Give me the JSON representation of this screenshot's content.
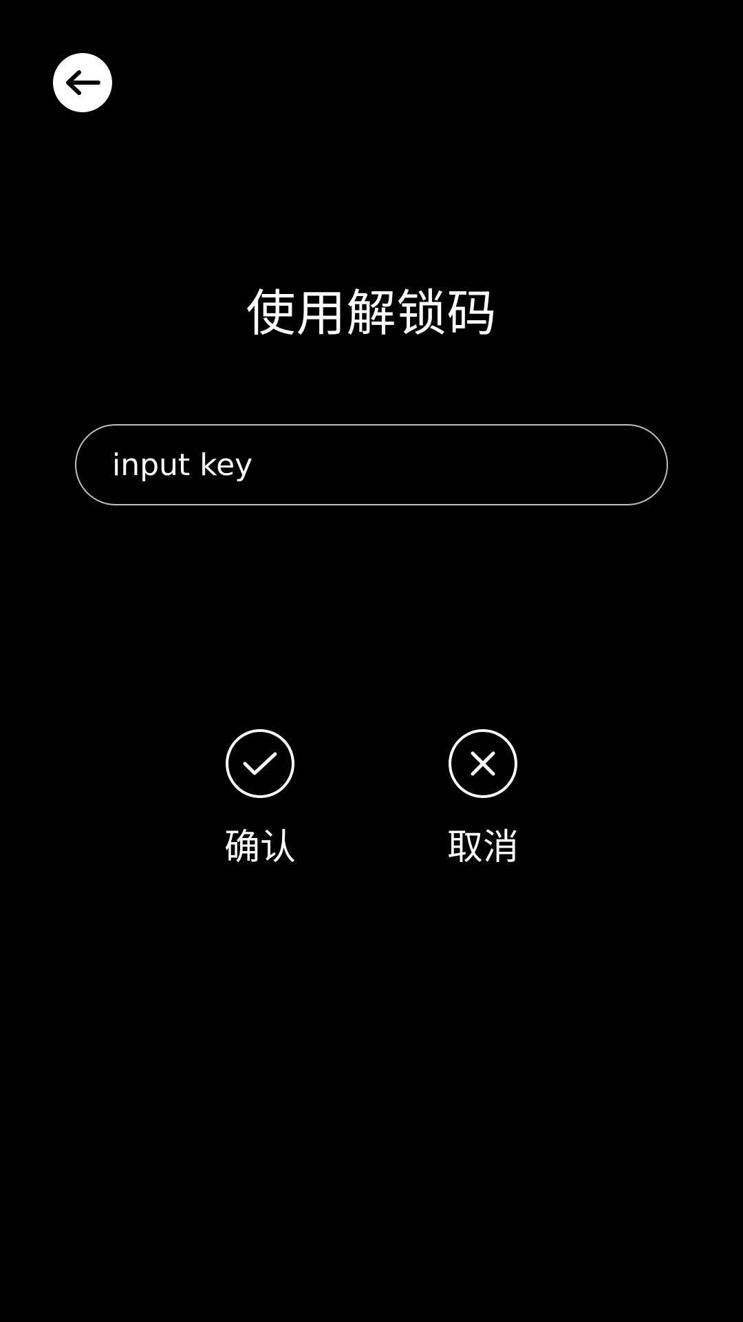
{
  "header": {
    "back_icon": "arrow-left-icon"
  },
  "page": {
    "title": "使用解锁码"
  },
  "key_input": {
    "placeholder": "input key",
    "value": ""
  },
  "actions": {
    "confirm": {
      "label": "确认",
      "icon": "check-icon"
    },
    "cancel": {
      "label": "取消",
      "icon": "close-icon"
    }
  },
  "colors": {
    "background": "#000000",
    "foreground": "#ffffff",
    "input_border": "#bfbfbf"
  }
}
